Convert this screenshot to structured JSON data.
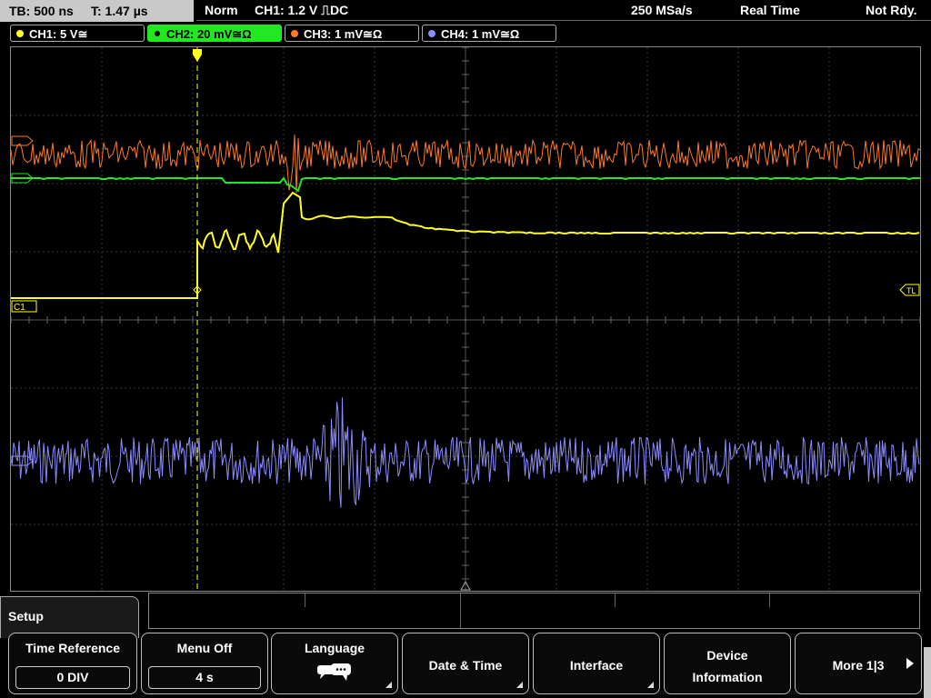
{
  "status": {
    "tb": "TB: 500 ns",
    "t": "T: 1.47 µs",
    "mode": "Norm",
    "trigger": "CH1: 1.2 V ⎍DC",
    "sample_rate": "250 MSa/s",
    "acq": "Real Time",
    "state": "Not Rdy."
  },
  "channels": [
    {
      "label": "CH1: 5 V≅",
      "color": "#ffff1e"
    },
    {
      "label": "CH2: 20 mV≅Ω",
      "color": "#22e822"
    },
    {
      "label": "CH3: 1 mV≅Ω",
      "color": "#ff7a1e"
    },
    {
      "label": "CH4: 1 mV≅Ω",
      "color": "#8c8cff"
    }
  ],
  "markers": {
    "c1": "C1",
    "tl": "TL"
  },
  "menu": {
    "title": "Setup",
    "keys": [
      {
        "label": "Time Reference",
        "value": "0 DIV"
      },
      {
        "label": "Menu Off",
        "value": "4 s"
      },
      {
        "label": "Language"
      },
      {
        "label": "Date & Time"
      },
      {
        "label": "Interface"
      },
      {
        "label": "Device",
        "label2": "Information"
      },
      {
        "label": "More 1|3"
      }
    ]
  },
  "icons": {
    "language": "speech-bubbles-icon",
    "trigger_marker": "trigger-arrow-icon",
    "more": "right-arrow-icon"
  }
}
